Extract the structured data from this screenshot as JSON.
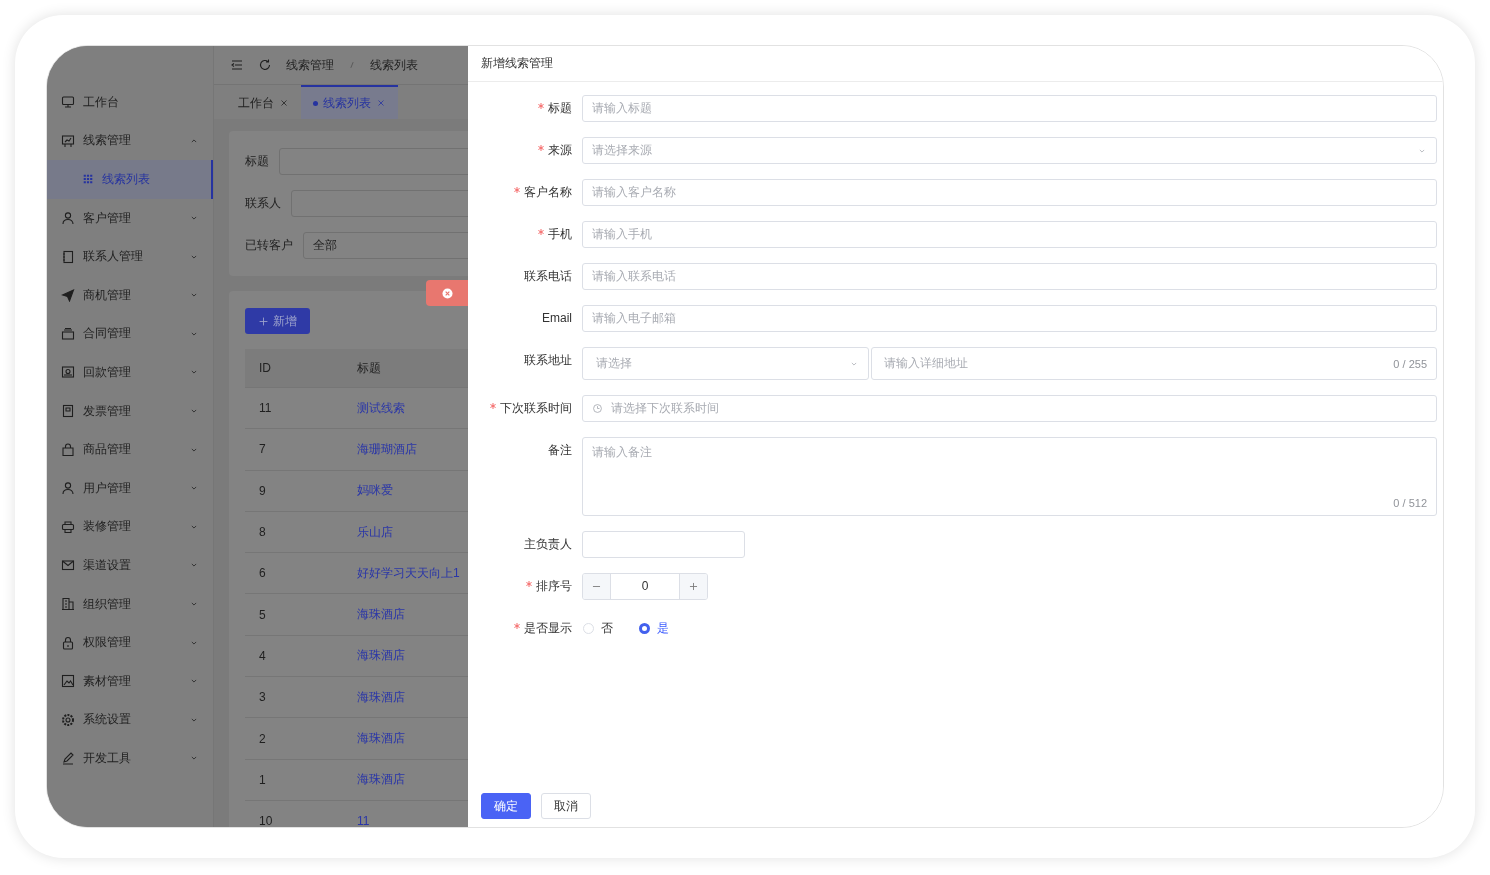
{
  "sidebar": {
    "items": [
      {
        "label": "工作台",
        "kind": "link",
        "selected": false
      },
      {
        "label": "线索管理",
        "kind": "group",
        "selected": false,
        "expanded": true,
        "children": [
          {
            "label": "线索列表",
            "selected": true
          }
        ]
      },
      {
        "label": "客户管理",
        "kind": "group",
        "selected": false,
        "expanded": false
      },
      {
        "label": "联系人管理",
        "kind": "group",
        "selected": false,
        "expanded": false
      },
      {
        "label": "商机管理",
        "kind": "group",
        "selected": false,
        "expanded": false
      },
      {
        "label": "合同管理",
        "kind": "group",
        "selected": false,
        "expanded": false
      },
      {
        "label": "回款管理",
        "kind": "group",
        "selected": false,
        "expanded": false
      },
      {
        "label": "发票管理",
        "kind": "group",
        "selected": false,
        "expanded": false
      },
      {
        "label": "商品管理",
        "kind": "group",
        "selected": false,
        "expanded": false
      },
      {
        "label": "用户管理",
        "kind": "group",
        "selected": false,
        "expanded": false
      },
      {
        "label": "装修管理",
        "kind": "group",
        "selected": false,
        "expanded": false
      },
      {
        "label": "渠道设置",
        "kind": "group",
        "selected": false,
        "expanded": false
      },
      {
        "label": "组织管理",
        "kind": "group",
        "selected": false,
        "expanded": false
      },
      {
        "label": "权限管理",
        "kind": "group",
        "selected": false,
        "expanded": false
      },
      {
        "label": "素材管理",
        "kind": "group",
        "selected": false,
        "expanded": false
      },
      {
        "label": "系统设置",
        "kind": "group",
        "selected": false,
        "expanded": false
      },
      {
        "label": "开发工具",
        "kind": "group",
        "selected": false,
        "expanded": false
      }
    ]
  },
  "breadcrumb": [
    "线索管理",
    "线索列表"
  ],
  "tabs": [
    {
      "label": "工作台",
      "selected": false
    },
    {
      "label": "线索列表",
      "selected": true
    }
  ],
  "filters": [
    {
      "label": "标题"
    },
    {
      "label": "联系人"
    },
    {
      "label": "已转客户",
      "value": "全部"
    }
  ],
  "add_button": {
    "label": "新增"
  },
  "table": {
    "columns": [
      "ID",
      "标题"
    ],
    "rows": [
      [
        "11",
        "测试线索"
      ],
      [
        "7",
        "海珊瑚酒店"
      ],
      [
        "9",
        "妈咪爱"
      ],
      [
        "8",
        "乐山店"
      ],
      [
        "6",
        "好好学习天天向上1"
      ],
      [
        "5",
        "海珠酒店"
      ],
      [
        "4",
        "海珠酒店"
      ],
      [
        "3",
        "海珠酒店"
      ],
      [
        "2",
        "海珠酒店"
      ],
      [
        "1",
        "海珠酒店"
      ],
      [
        "10",
        "11"
      ]
    ]
  },
  "drawer": {
    "title": "新增线索管理",
    "fields": [
      {
        "kind": "text",
        "label": "标题",
        "required": true,
        "placeholder": "请输入标题"
      },
      {
        "kind": "select",
        "label": "来源",
        "required": true,
        "placeholder": "请选择来源"
      },
      {
        "kind": "text",
        "label": "客户名称",
        "required": true,
        "placeholder": "请输入客户名称"
      },
      {
        "kind": "text",
        "label": "手机",
        "required": true,
        "placeholder": "请输入手机"
      },
      {
        "kind": "text",
        "label": "联系电话",
        "required": false,
        "placeholder": "请输入联系电话"
      },
      {
        "kind": "text",
        "label": "Email",
        "required": false,
        "placeholder": "请输入电子邮箱"
      },
      {
        "kind": "address",
        "label": "联系地址",
        "required": false,
        "select_placeholder": "请选择",
        "placeholder": "请输入详细地址",
        "counter": "0 / 255"
      },
      {
        "kind": "datetime",
        "label": "下次联系时间",
        "required": true,
        "placeholder": "请选择下次联系时间"
      },
      {
        "kind": "textarea",
        "label": "备注",
        "required": false,
        "placeholder": "请输入备注",
        "counter": "0 / 512"
      },
      {
        "kind": "short",
        "label": "主负责人",
        "required": false
      },
      {
        "kind": "number",
        "label": "排序号",
        "required": true,
        "value": "0"
      },
      {
        "kind": "radio",
        "label": "是否显示",
        "required": true,
        "options": [
          {
            "label": "否",
            "selected": false
          },
          {
            "label": "是",
            "selected": true
          }
        ]
      }
    ],
    "buttons": [
      {
        "label": "确定",
        "kind": "primary"
      },
      {
        "label": "取消",
        "kind": "default"
      }
    ]
  }
}
